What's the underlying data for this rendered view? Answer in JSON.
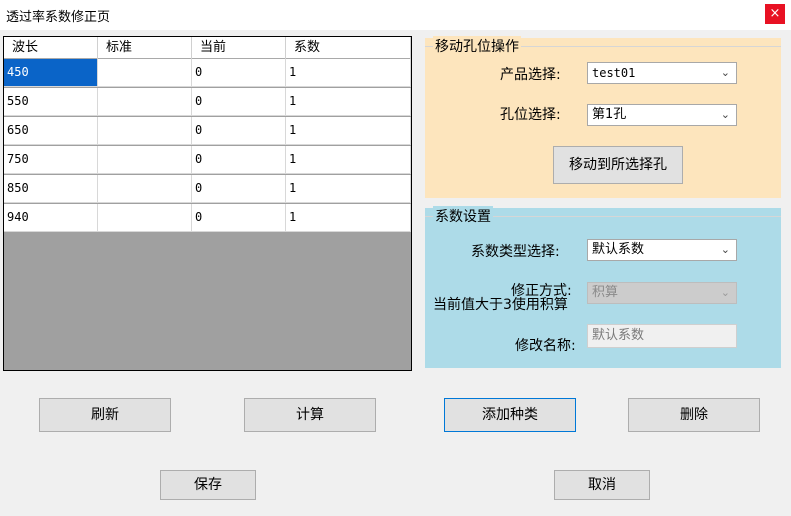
{
  "window": {
    "title": "透过率系数修正页",
    "close_icon": "×"
  },
  "grid": {
    "columns": [
      "波长",
      "标准",
      "当前",
      "系数"
    ],
    "rows": [
      [
        "450",
        "",
        "0",
        "1"
      ],
      [
        "550",
        "",
        "0",
        "1"
      ],
      [
        "650",
        "",
        "0",
        "1"
      ],
      [
        "750",
        "",
        "0",
        "1"
      ],
      [
        "850",
        "",
        "0",
        "1"
      ],
      [
        "940",
        "",
        "0",
        "1"
      ]
    ]
  },
  "move_group": {
    "title": "移动孔位操作",
    "product_label": "产品选择:",
    "product_value": "test01",
    "hole_label": "孔位选择:",
    "hole_value": "第1孔",
    "move_button": "移动到所选择孔"
  },
  "coef_group": {
    "title": "系数设置",
    "type_label": "系数类型选择:",
    "type_value": "默认系数",
    "correction_label_1": "修正方式:",
    "correction_label_2": "当前值大于3使用积算",
    "correction_value": "积算",
    "rename_label": "修改名称:",
    "rename_value": "默认系数"
  },
  "buttons": {
    "refresh": "刷新",
    "calculate": "计算",
    "add_type": "添加种类",
    "delete": "删除",
    "save": "保存",
    "cancel": "取消"
  },
  "colors": {
    "move_group_bg": "#fde5bd",
    "coef_group_bg": "#addbe8",
    "selection": "#0a64c8",
    "close_button": "#e81123"
  }
}
